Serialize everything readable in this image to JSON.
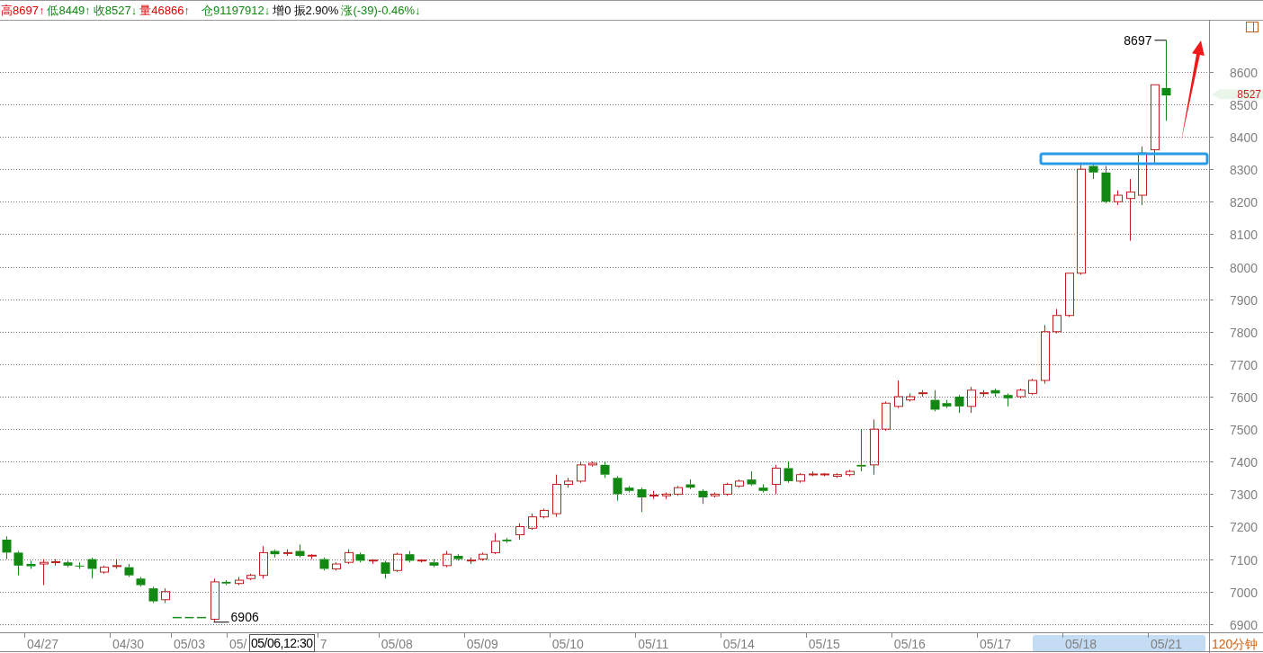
{
  "quote_bar": {
    "items": [
      {
        "text": "高8697↑",
        "color": "#e00000"
      },
      {
        "text": "低8449↑",
        "color": "#118811"
      },
      {
        "text": "收8527↓",
        "color": "#118811"
      },
      {
        "text": "量46866↑",
        "color": "#e00000"
      },
      {
        "text": "仓91197912↓",
        "color": "#118811"
      },
      {
        "text": "增0",
        "color": "#000000"
      },
      {
        "text": "振2.90%",
        "color": "#000000"
      },
      {
        "text": "涨(-39)-0.46%↓",
        "color": "#118811"
      }
    ]
  },
  "chart": {
    "high_marker": "8697",
    "low_marker": "6906",
    "last_price": "8527",
    "cursor_time": "05/06,12:30",
    "period": "120分钟",
    "axis_selected": true,
    "chart_data": {
      "type": "candlestick",
      "grid": true,
      "ylim": [
        6811,
        8760
      ],
      "categories": [
        null,
        null,
        null,
        "04/27",
        null,
        null,
        null,
        null,
        null,
        null,
        "04/30",
        null,
        null,
        null,
        null,
        "05/03",
        null,
        null,
        null,
        "05/",
        null,
        null,
        null,
        null,
        null,
        null,
        "7",
        null,
        null,
        null,
        null,
        null,
        "05/08",
        null,
        null,
        null,
        null,
        null,
        null,
        "05/09",
        null,
        null,
        null,
        null,
        null,
        null,
        "05/10",
        null,
        null,
        null,
        null,
        null,
        null,
        "05/11",
        null,
        null,
        null,
        null,
        null,
        null,
        "05/14",
        null,
        null,
        null,
        null,
        null,
        null,
        "05/15",
        null,
        null,
        null,
        null,
        null,
        null,
        "05/16",
        null,
        null,
        null,
        null,
        null,
        null,
        "05/17",
        null,
        null,
        null,
        null,
        null,
        null,
        "05/18",
        null,
        null,
        null,
        null,
        null,
        null,
        "05/21",
        null,
        null,
        null
      ],
      "yticks": [
        6900,
        7000,
        7100,
        7200,
        7300,
        7400,
        7500,
        7600,
        7700,
        7800,
        7900,
        8000,
        8100,
        8200,
        8300,
        8400,
        8500,
        8600
      ],
      "ohlc": [
        [
          7160,
          7170,
          7100,
          7120
        ],
        [
          7120,
          7125,
          7050,
          7080
        ],
        [
          7085,
          7095,
          7070,
          7078
        ],
        [
          7085,
          7100,
          7020,
          7090
        ],
        [
          7090,
          7100,
          7080,
          7092
        ],
        [
          7090,
          7095,
          7075,
          7080
        ],
        [
          7080,
          7090,
          7070,
          7078
        ],
        [
          7100,
          7105,
          7040,
          7070
        ],
        [
          7060,
          7080,
          7055,
          7075
        ],
        [
          7078,
          7100,
          7070,
          7080
        ],
        [
          7075,
          7085,
          7045,
          7050
        ],
        [
          7040,
          7045,
          7015,
          7020
        ],
        [
          7010,
          7015,
          6965,
          6970
        ],
        [
          6975,
          7010,
          6965,
          7000
        ],
        [
          6920,
          6920,
          6920,
          6920
        ],
        [
          6920,
          6920,
          6920,
          6920
        ],
        [
          6920,
          6920,
          6920,
          6920
        ],
        [
          6915,
          7040,
          6906,
          7030
        ],
        [
          7030,
          7035,
          7020,
          7025
        ],
        [
          7025,
          7045,
          7020,
          7035
        ],
        [
          7040,
          7055,
          7035,
          7050
        ],
        [
          7050,
          7140,
          7040,
          7120
        ],
        [
          7125,
          7130,
          7105,
          7115
        ],
        [
          7118,
          7130,
          7110,
          7120
        ],
        [
          7125,
          7145,
          7105,
          7110
        ],
        [
          7110,
          7115,
          7100,
          7112
        ],
        [
          7100,
          7105,
          7065,
          7070
        ],
        [
          7070,
          7090,
          7065,
          7085
        ],
        [
          7090,
          7130,
          7085,
          7120
        ],
        [
          7115,
          7120,
          7090,
          7095
        ],
        [
          7095,
          7100,
          7085,
          7097
        ],
        [
          7090,
          7095,
          7040,
          7055
        ],
        [
          7065,
          7120,
          7060,
          7115
        ],
        [
          7115,
          7125,
          7090,
          7095
        ],
        [
          7095,
          7100,
          7090,
          7097
        ],
        [
          7090,
          7100,
          7075,
          7080
        ],
        [
          7080,
          7125,
          7075,
          7115
        ],
        [
          7110,
          7115,
          7095,
          7100
        ],
        [
          7095,
          7105,
          7085,
          7097
        ],
        [
          7100,
          7120,
          7095,
          7115
        ],
        [
          7120,
          7180,
          7115,
          7155
        ],
        [
          7160,
          7165,
          7150,
          7155
        ],
        [
          7175,
          7210,
          7160,
          7200
        ],
        [
          7195,
          7240,
          7190,
          7230
        ],
        [
          7230,
          7255,
          7225,
          7250
        ],
        [
          7240,
          7360,
          7230,
          7330
        ],
        [
          7330,
          7350,
          7320,
          7340
        ],
        [
          7340,
          7400,
          7335,
          7390
        ],
        [
          7390,
          7400,
          7385,
          7395
        ],
        [
          7390,
          7400,
          7350,
          7360
        ],
        [
          7350,
          7355,
          7280,
          7300
        ],
        [
          7320,
          7325,
          7305,
          7310
        ],
        [
          7315,
          7320,
          7245,
          7290
        ],
        [
          7295,
          7310,
          7285,
          7297
        ],
        [
          7295,
          7305,
          7285,
          7300
        ],
        [
          7300,
          7325,
          7295,
          7320
        ],
        [
          7330,
          7345,
          7315,
          7320
        ],
        [
          7310,
          7315,
          7270,
          7290
        ],
        [
          7295,
          7305,
          7290,
          7300
        ],
        [
          7300,
          7335,
          7295,
          7330
        ],
        [
          7325,
          7345,
          7320,
          7340
        ],
        [
          7345,
          7370,
          7325,
          7330
        ],
        [
          7320,
          7330,
          7305,
          7310
        ],
        [
          7330,
          7390,
          7300,
          7380
        ],
        [
          7380,
          7400,
          7335,
          7340
        ],
        [
          7340,
          7365,
          7335,
          7360
        ],
        [
          7360,
          7370,
          7355,
          7362
        ],
        [
          7360,
          7365,
          7355,
          7362
        ],
        [
          7355,
          7365,
          7350,
          7360
        ],
        [
          7360,
          7375,
          7355,
          7370
        ],
        [
          7390,
          7500,
          7370,
          7385
        ],
        [
          7390,
          7530,
          7360,
          7500
        ],
        [
          7500,
          7585,
          7495,
          7580
        ],
        [
          7570,
          7650,
          7565,
          7600
        ],
        [
          7590,
          7610,
          7585,
          7600
        ],
        [
          7610,
          7620,
          7600,
          7612
        ],
        [
          7590,
          7620,
          7555,
          7560
        ],
        [
          7580,
          7590,
          7565,
          7570
        ],
        [
          7600,
          7605,
          7550,
          7570
        ],
        [
          7570,
          7630,
          7550,
          7620
        ],
        [
          7610,
          7620,
          7600,
          7612
        ],
        [
          7620,
          7625,
          7600,
          7610
        ],
        [
          7605,
          7610,
          7570,
          7595
        ],
        [
          7600,
          7625,
          7595,
          7620
        ],
        [
          7610,
          7655,
          7605,
          7650
        ],
        [
          7650,
          7820,
          7640,
          7800
        ],
        [
          7800,
          7870,
          7795,
          7850
        ],
        [
          7850,
          7980,
          7845,
          7980
        ],
        [
          7980,
          8320,
          7975,
          8300
        ],
        [
          8310,
          8315,
          8270,
          8290
        ],
        [
          8290,
          8310,
          8195,
          8200
        ],
        [
          8200,
          8235,
          8190,
          8220
        ],
        [
          8210,
          8270,
          8080,
          8230
        ],
        [
          8220,
          8370,
          8190,
          8350
        ],
        [
          8360,
          8560,
          8320,
          8560
        ],
        [
          8550,
          8697,
          8449,
          8527
        ],
        null,
        null,
        null
      ]
    }
  }
}
